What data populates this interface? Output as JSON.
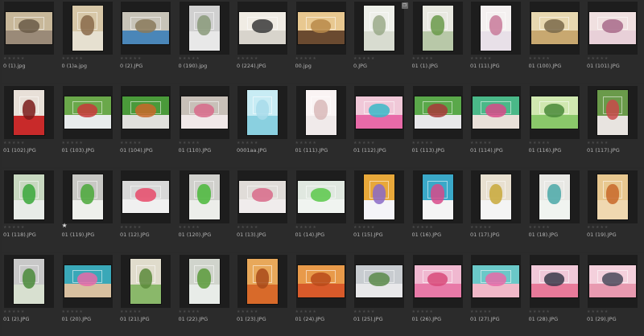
{
  "star_glyph_empty": "★★★★★",
  "star_glyph_rated": "★",
  "badge_icon": "copy-icon",
  "files": [
    {
      "name": "0 (1).jpg",
      "orient": "landscape",
      "colors": [
        "#9a8a78",
        "#6a5b48",
        "#c8b89a"
      ]
    },
    {
      "name": "0 (1)a.jpg",
      "orient": "portrait",
      "colors": [
        "#e6e0d0",
        "#8a6a4a",
        "#d7c7a7"
      ]
    },
    {
      "name": "0 (2).JPG",
      "orient": "landscape",
      "colors": [
        "#4a86b8",
        "#8a7a5a",
        "#c8c4b8"
      ]
    },
    {
      "name": "0 (190).jpg",
      "orient": "portrait",
      "colors": [
        "#e8e8e8",
        "#8a9a7a",
        "#d0d0d0"
      ]
    },
    {
      "name": "0 (224).JPG",
      "orient": "landscape",
      "colors": [
        "#d8d4cc",
        "#3a3a3a",
        "#f0ece4"
      ]
    },
    {
      "name": "00.jpg",
      "orient": "landscape",
      "colors": [
        "#6a4a30",
        "#b88a4a",
        "#e8c890"
      ]
    },
    {
      "name": "0.JPG",
      "orient": "portrait",
      "colors": [
        "#d8dcd0",
        "#9aaa8a",
        "#eef0ea"
      ],
      "badge": true
    },
    {
      "name": "01 (1).JPG",
      "orient": "portrait",
      "colors": [
        "#b8c8a8",
        "#6a9a4a",
        "#e8e8e0"
      ]
    },
    {
      "name": "01 (11).JPG",
      "orient": "portrait",
      "colors": [
        "#e8e0e8",
        "#c87a9a",
        "#f4f0f0"
      ]
    },
    {
      "name": "01 (100).JPG",
      "orient": "landscape",
      "colors": [
        "#c8a870",
        "#7a6a4a",
        "#e8d8b0"
      ]
    },
    {
      "name": "01 (101).JPG",
      "orient": "landscape",
      "colors": [
        "#e8d0d8",
        "#a86a8a",
        "#f0e0e0"
      ]
    },
    {
      "name": "01 (102).JPG",
      "orient": "portrait",
      "colors": [
        "#c82a2a",
        "#7a1a1a",
        "#e8e0d8"
      ]
    },
    {
      "name": "01 (103).JPG",
      "orient": "landscape",
      "colors": [
        "#e8ecec",
        "#c83a3a",
        "#6aa84a"
      ]
    },
    {
      "name": "01 (104).JPG",
      "orient": "landscape",
      "colors": [
        "#e0e0dc",
        "#c8682a",
        "#4a9a3a"
      ]
    },
    {
      "name": "01 (110).JPG",
      "orient": "landscape",
      "colors": [
        "#f0e8e8",
        "#d86a8a",
        "#c8c0b8"
      ]
    },
    {
      "name": "0001aa.JPG",
      "orient": "portrait",
      "colors": [
        "#8ad0e0",
        "#a8dcea",
        "#c8ecf4"
      ]
    },
    {
      "name": "01 (111).JPG",
      "orient": "portrait",
      "colors": [
        "#f0eaea",
        "#d8b8b8",
        "#faf4f4"
      ]
    },
    {
      "name": "01 (112).JPG",
      "orient": "landscape",
      "colors": [
        "#e86aa8",
        "#3ab8c8",
        "#f0c8d8"
      ]
    },
    {
      "name": "01 (113).JPG",
      "orient": "landscape",
      "colors": [
        "#e8e8ea",
        "#a83a3a",
        "#5aa84a"
      ]
    },
    {
      "name": "01 (114).JPG",
      "orient": "landscape",
      "colors": [
        "#e8e0d8",
        "#d84a8a",
        "#4ab888"
      ]
    },
    {
      "name": "01 (116).JPG",
      "orient": "landscape",
      "colors": [
        "#8ac86a",
        "#4a8a3a",
        "#d0e8b0"
      ]
    },
    {
      "name": "01 (117).JPG",
      "orient": "portrait",
      "colors": [
        "#e8e4e0",
        "#c84a4a",
        "#6a9a4a"
      ]
    },
    {
      "name": "01 (118).JPG",
      "orient": "portrait",
      "colors": [
        "#e8ece8",
        "#3aa83a",
        "#c8d8c0"
      ]
    },
    {
      "name": "01 (119).JPG",
      "orient": "portrait",
      "colors": [
        "#eef0ec",
        "#4aa83a",
        "#c8c8c4"
      ],
      "rated": true
    },
    {
      "name": "01 (12).JPG",
      "orient": "landscape",
      "colors": [
        "#f0f0f0",
        "#e84a6a",
        "#d8d8d8"
      ]
    },
    {
      "name": "01 (120).JPG",
      "orient": "portrait",
      "colors": [
        "#eceeea",
        "#4ab83a",
        "#d0d0cc"
      ]
    },
    {
      "name": "01 (13).JPG",
      "orient": "landscape",
      "colors": [
        "#f0ecec",
        "#d86a8a",
        "#e0dcd8"
      ]
    },
    {
      "name": "01 (14).JPG",
      "orient": "landscape",
      "colors": [
        "#f0f4f0",
        "#5ac84a",
        "#e0e8e0"
      ]
    },
    {
      "name": "01 (15).JPG",
      "orient": "portrait",
      "colors": [
        "#f4f4f8",
        "#8a6ac8",
        "#e8a83a"
      ]
    },
    {
      "name": "01 (16).JPG",
      "orient": "portrait",
      "colors": [
        "#f4f4f4",
        "#d84a8a",
        "#3aa8c8"
      ]
    },
    {
      "name": "01 (17).JPG",
      "orient": "portrait",
      "colors": [
        "#f4f4f4",
        "#c8a83a",
        "#e8e0d0"
      ]
    },
    {
      "name": "01 (18).JPG",
      "orient": "portrait",
      "colors": [
        "#f0f4f0",
        "#4aa8a8",
        "#e8e8e4"
      ]
    },
    {
      "name": "01 (19).JPG",
      "orient": "portrait",
      "colors": [
        "#f0d8b0",
        "#c8682a",
        "#e8c890"
      ]
    },
    {
      "name": "01 (2).JPG",
      "orient": "portrait",
      "colors": [
        "#d8e0d0",
        "#4a8a3a",
        "#c8c8c8"
      ]
    },
    {
      "name": "01 (20).JPG",
      "orient": "landscape",
      "colors": [
        "#d8c0a0",
        "#e86aa8",
        "#3aa8b8"
      ]
    },
    {
      "name": "01 (21).JPG",
      "orient": "portrait",
      "colors": [
        "#8ab86a",
        "#5a8a3a",
        "#e0dccc"
      ]
    },
    {
      "name": "01 (22).JPG",
      "orient": "portrait",
      "colors": [
        "#e8ece8",
        "#5a9a3a",
        "#d0d4cc"
      ]
    },
    {
      "name": "01 (23).JPG",
      "orient": "portrait",
      "colors": [
        "#d86a2a",
        "#a84a1a",
        "#e8a85a"
      ]
    },
    {
      "name": "01 (24).JPG",
      "orient": "landscape",
      "colors": [
        "#d85a2a",
        "#b84a1a",
        "#e89a4a"
      ]
    },
    {
      "name": "01 (25).JPG",
      "orient": "landscape",
      "colors": [
        "#e8e8ea",
        "#5a8a4a",
        "#c8ccd0"
      ]
    },
    {
      "name": "01 (26).JPG",
      "orient": "landscape",
      "colors": [
        "#e87aa8",
        "#d84a7a",
        "#f0b8d0"
      ]
    },
    {
      "name": "01 (27).JPG",
      "orient": "landscape",
      "colors": [
        "#f0b8c8",
        "#e86aa8",
        "#6ac8c8"
      ]
    },
    {
      "name": "01 (28).JPG",
      "orient": "landscape",
      "colors": [
        "#e87a9a",
        "#3a3a4a",
        "#f0c8d8"
      ]
    },
    {
      "name": "01 (29).JPG",
      "orient": "landscape",
      "colors": [
        "#e89ab0",
        "#4a4a5a",
        "#f4d0dc"
      ]
    }
  ]
}
